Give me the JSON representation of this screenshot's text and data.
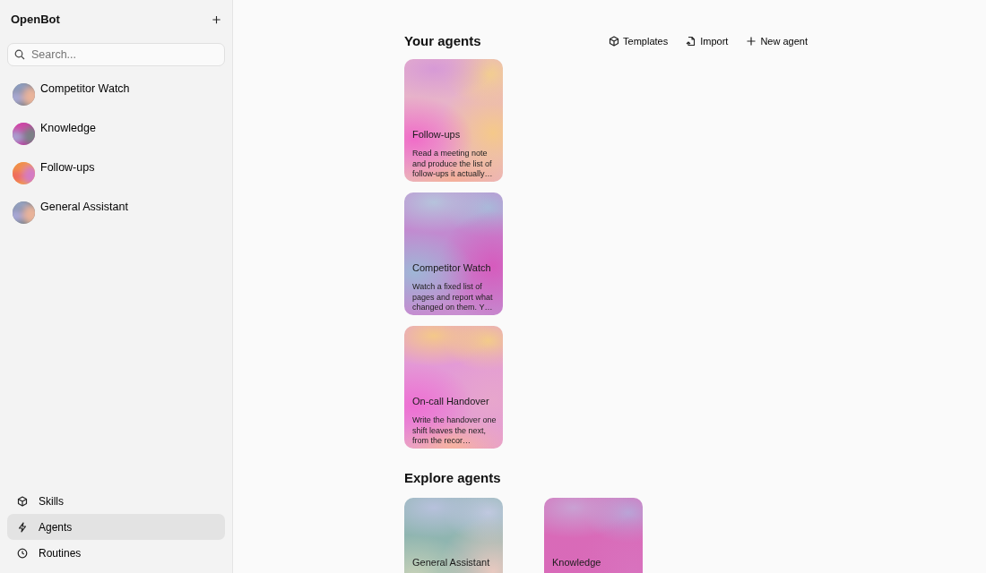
{
  "sidebar": {
    "title": "OpenBot",
    "search": {
      "placeholder": "Search..."
    },
    "agents": [
      {
        "name": "Competitor Watch"
      },
      {
        "name": "Knowledge"
      },
      {
        "name": "Follow-ups"
      },
      {
        "name": "General Assistant"
      }
    ],
    "nav": [
      {
        "label": "Skills",
        "selected": false
      },
      {
        "label": "Agents",
        "selected": true
      },
      {
        "label": "Routines",
        "selected": false
      }
    ]
  },
  "your_agents": {
    "title": "Your agents",
    "actions": [
      {
        "label": "Templates"
      },
      {
        "label": "Import"
      },
      {
        "label": "New agent"
      }
    ],
    "cards": [
      {
        "title": "Follow-ups",
        "description": "Read a meeting note and produce the list of follow-ups it actually…"
      },
      {
        "title": "Competitor Watch",
        "description": "Watch a fixed list of pages and report what changed on them. Y…"
      },
      {
        "title": "On-call Handover",
        "description": "Write the handover one shift leaves the next, from the recor…"
      }
    ]
  },
  "explore_agents": {
    "title": "Explore agents",
    "cards": [
      {
        "title": "General Assistant"
      },
      {
        "title": "Knowledge"
      }
    ]
  }
}
